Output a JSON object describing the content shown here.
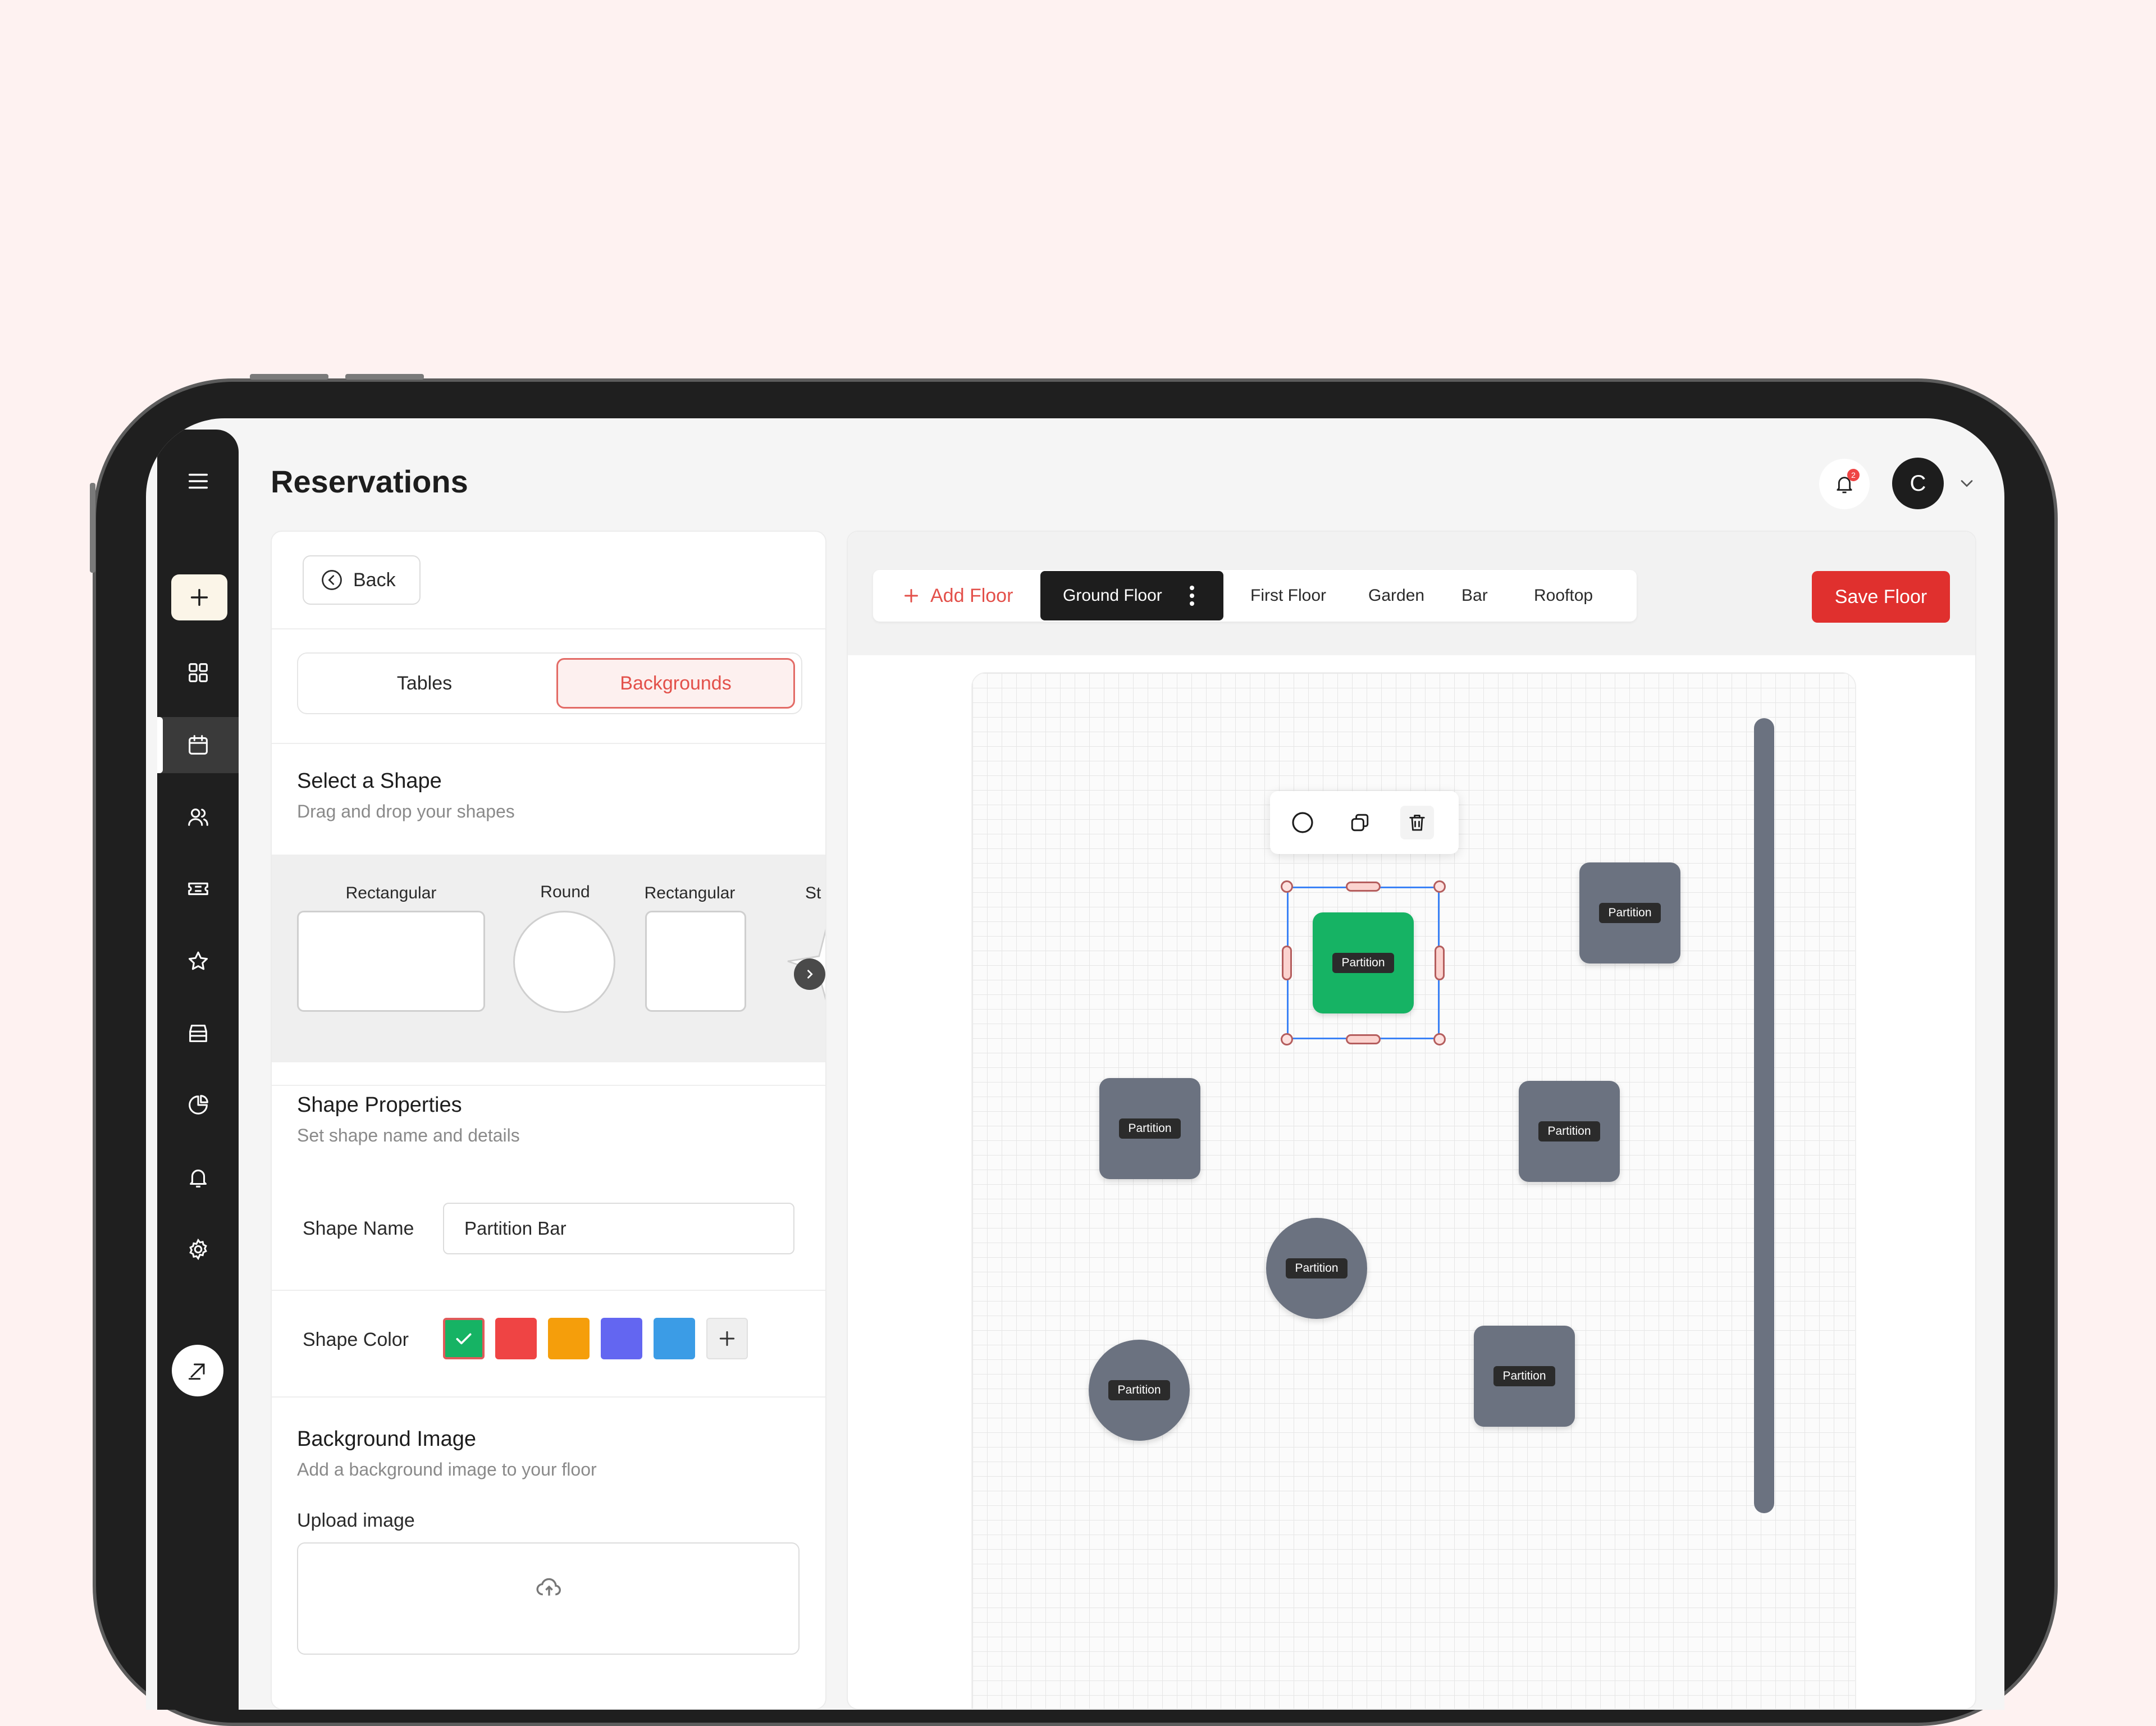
{
  "app": {
    "title": "Reservations",
    "avatar_initial": "C",
    "notification_count": "2"
  },
  "sidebar": {
    "items": [
      {
        "name": "menu-icon"
      },
      {
        "name": "add-icon"
      },
      {
        "name": "dashboard-icon"
      },
      {
        "name": "calendar-icon",
        "active": true
      },
      {
        "name": "users-icon"
      },
      {
        "name": "ticket-icon"
      },
      {
        "name": "star-icon"
      },
      {
        "name": "store-icon"
      },
      {
        "name": "pie-chart-icon"
      },
      {
        "name": "bell-icon"
      },
      {
        "name": "gear-icon"
      },
      {
        "name": "expand-icon"
      }
    ]
  },
  "left_panel": {
    "back_label": "Back",
    "tabs": [
      {
        "label": "Tables"
      },
      {
        "label": "Backgrounds",
        "active": true
      }
    ],
    "select_shape": {
      "title": "Select a Shape",
      "subtitle": "Drag and drop your shapes",
      "shapes": [
        {
          "label": "Rectangular"
        },
        {
          "label": "Round"
        },
        {
          "label": "Rectangular"
        },
        {
          "label": "St"
        }
      ]
    },
    "shape_properties": {
      "title": "Shape Properties",
      "subtitle": "Set shape name and details",
      "name_label": "Shape Name",
      "name_value": "Partition Bar",
      "color_label": "Shape Color",
      "colors": [
        "#16b364",
        "#ef4444",
        "#f59e0b",
        "#6366f1",
        "#3b9ce6"
      ],
      "selected_color": "#16b364"
    },
    "background_image": {
      "title": "Background Image",
      "subtitle": "Add a background image to your floor",
      "upload_label": "Upload image"
    }
  },
  "floor_editor": {
    "add_floor_label": "Add Floor",
    "floors": [
      {
        "label": "Ground Floor",
        "active": true
      },
      {
        "label": "First Floor"
      },
      {
        "label": "Garden"
      },
      {
        "label": "Bar"
      },
      {
        "label": "Rooftop"
      }
    ],
    "save_label": "Save Floor",
    "canvas_shapes": [
      {
        "label": "Partition",
        "type": "square",
        "color": "#16b364",
        "selected": true
      },
      {
        "label": "Partition",
        "type": "square",
        "color": "#6b7280"
      },
      {
        "label": "Partition",
        "type": "square",
        "color": "#6b7280"
      },
      {
        "label": "Partition",
        "type": "square",
        "color": "#6b7280"
      },
      {
        "label": "Partition",
        "type": "round",
        "color": "#6b7280"
      },
      {
        "label": "Partition",
        "type": "round",
        "color": "#6b7280"
      },
      {
        "label": "Partition",
        "type": "square",
        "color": "#6b7280"
      },
      {
        "label": "",
        "type": "bar",
        "color": "#6b7280"
      }
    ],
    "shape_tools": [
      "circle-icon",
      "duplicate-icon",
      "trash-icon"
    ]
  }
}
